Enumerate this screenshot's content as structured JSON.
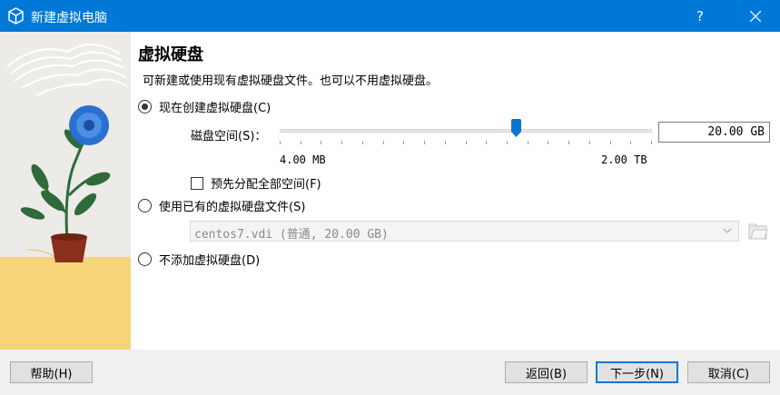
{
  "window": {
    "title": "新建虚拟电脑",
    "help_label": "?"
  },
  "page": {
    "heading": "虚拟硬盘",
    "subtitle": "可新建或使用现有虚拟硬盘文件。也可以不用虚拟硬盘。"
  },
  "options": {
    "create_now": {
      "label": "现在创建虚拟硬盘(C)",
      "selected": true
    },
    "use_existing": {
      "label": "使用已有的虚拟硬盘文件(S)",
      "selected": false
    },
    "no_disk": {
      "label": "不添加虚拟硬盘(D)",
      "selected": false
    }
  },
  "disk_size": {
    "label": "磁盘空间(S)：",
    "value": "20.00 GB",
    "min_label": "4.00 MB",
    "max_label": "2.00 TB",
    "slider_fraction": 0.635,
    "tick_count": 19
  },
  "preallocate": {
    "label": "预先分配全部空间(F)",
    "checked": false
  },
  "existing_file": {
    "selected": "centos7.vdi (普通, 20.00 GB)"
  },
  "buttons": {
    "help": "帮助(H)",
    "back": "返回(B)",
    "next": "下一步(N)",
    "cancel": "取消(C)"
  },
  "colors": {
    "titlebar": "#0078d7",
    "accent": "#0a74d4"
  },
  "icons": {
    "app": "virtualbox-cube-icon",
    "close": "close-icon",
    "combo": "chevron-down-icon",
    "folder": "folder-open-icon"
  }
}
